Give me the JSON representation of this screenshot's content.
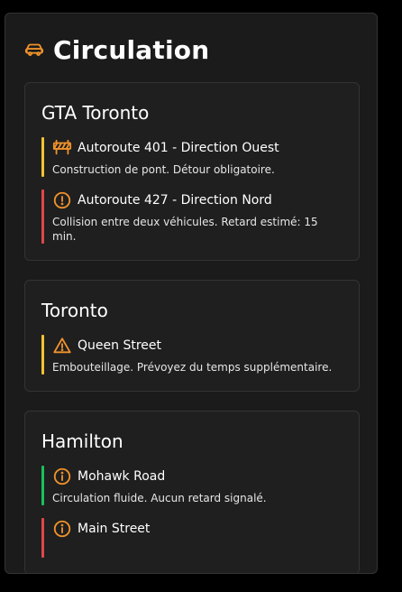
{
  "panel": {
    "title": "Circulation",
    "icon": "car-icon",
    "accent_color": "#f0922b"
  },
  "status_colors": {
    "warning": "#f2c232",
    "severe": "#e0474c",
    "clear": "#19c15c"
  },
  "regions": [
    {
      "name": "GTA Toronto",
      "incidents": [
        {
          "title": "Autoroute 401 - Direction Ouest",
          "description": "Construction de pont. Détour obligatoire.",
          "icon": "roadblock-icon",
          "status": "warning"
        },
        {
          "title": "Autoroute 427 - Direction Nord",
          "description": "Collision entre deux véhicules. Retard estimé: 15 min.",
          "icon": "alert-circle-icon",
          "status": "severe"
        }
      ]
    },
    {
      "name": "Toronto",
      "incidents": [
        {
          "title": "Queen Street",
          "description": "Embouteillage. Prévoyez du temps supplémentaire.",
          "icon": "warning-triangle-icon",
          "status": "warning"
        }
      ]
    },
    {
      "name": "Hamilton",
      "incidents": [
        {
          "title": "Mohawk Road",
          "description": "Circulation fluide. Aucun retard signalé.",
          "icon": "info-circle-icon",
          "status": "clear"
        },
        {
          "title": "Main Street",
          "description": "",
          "icon": "info-circle-icon",
          "status": "severe"
        }
      ]
    }
  ]
}
